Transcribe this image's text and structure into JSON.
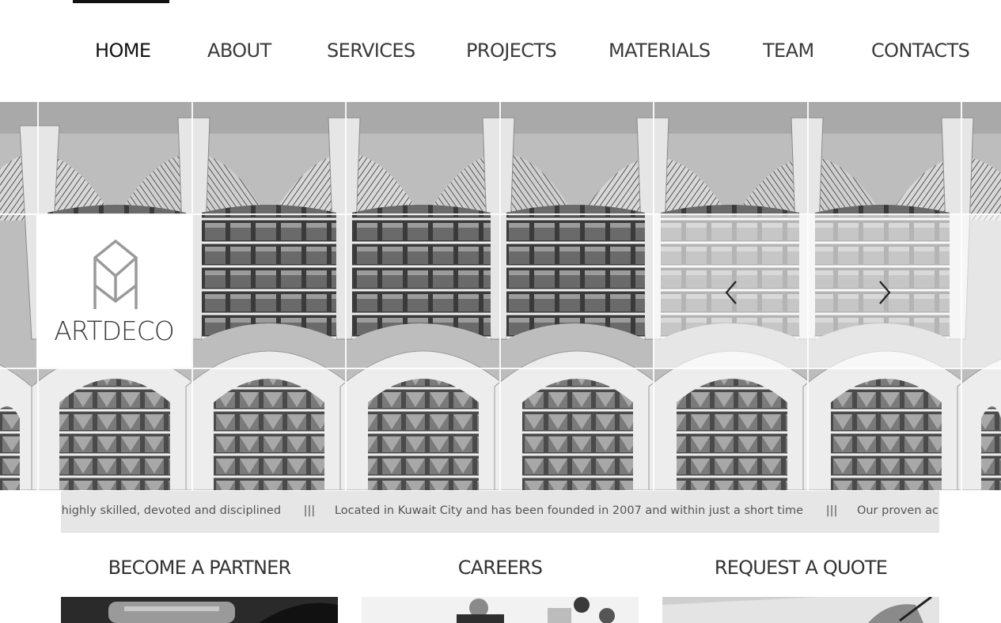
{
  "nav": {
    "items": [
      {
        "label": "HOME"
      },
      {
        "label": "ABOUT"
      },
      {
        "label": "SERVICES"
      },
      {
        "label": "PROJECTS"
      },
      {
        "label": "MATERIALS"
      },
      {
        "label": "TEAM"
      },
      {
        "label": "CONTACTS"
      }
    ],
    "active": "HOME"
  },
  "hero": {
    "logo_text": "ARTDECO",
    "prev_icon": "chevron-left-icon",
    "next_icon": "chevron-right-icon"
  },
  "ticker": {
    "items": [
      "r highly skilled, devoted and disciplined",
      "Located in Kuwait City and has been founded in 2007 and within just a short time",
      "Our proven achievements derive fr"
    ],
    "separator": "|||"
  },
  "columns": [
    {
      "title": "BECOME A PARTNER"
    },
    {
      "title": "CAREERS"
    },
    {
      "title": "REQUEST A QUOTE"
    }
  ],
  "colors": {
    "ticker_bg": "#e6e6e6",
    "text_dark": "#333333",
    "nav_active": "#111111"
  }
}
